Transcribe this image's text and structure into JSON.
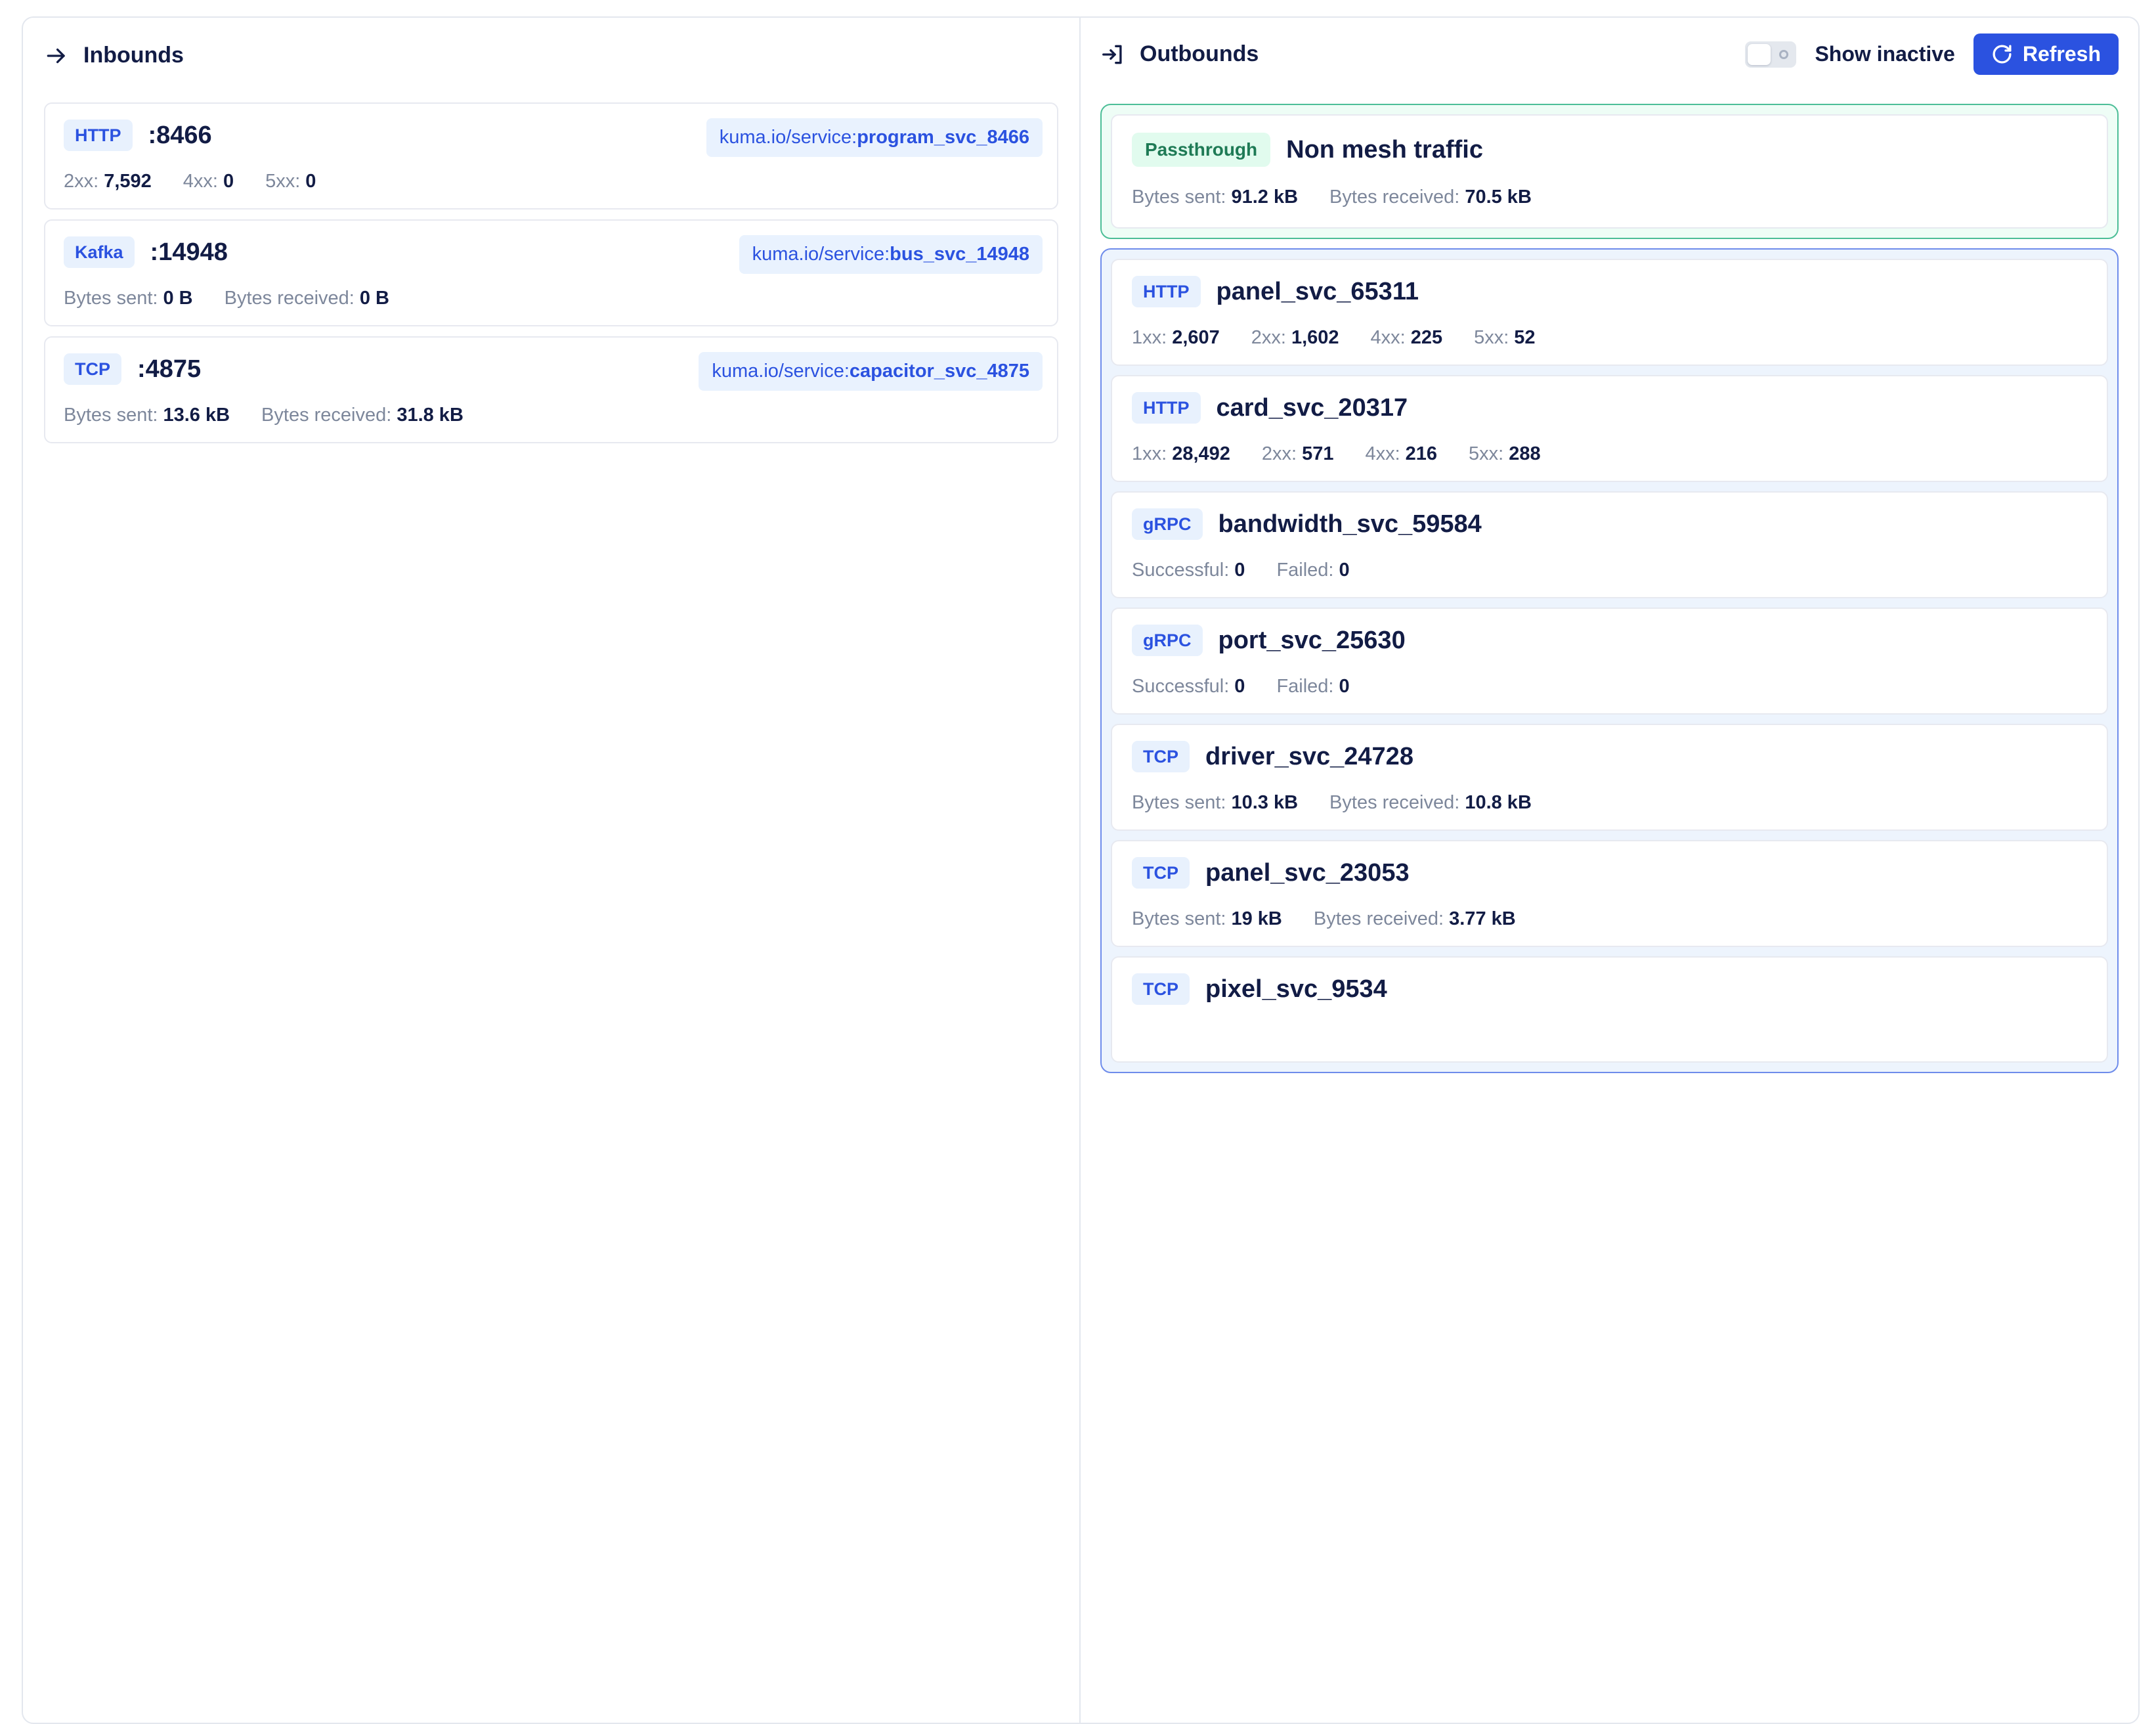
{
  "inbounds": {
    "title": "Inbounds",
    "items": [
      {
        "protocol": "HTTP",
        "port": ":8466",
        "tag_label": "kuma.io/service:",
        "tag_value": "program_svc_8466",
        "stats": [
          {
            "label": "2xx:",
            "value": "7,592"
          },
          {
            "label": "4xx:",
            "value": "0"
          },
          {
            "label": "5xx:",
            "value": "0"
          }
        ]
      },
      {
        "protocol": "Kafka",
        "port": ":14948",
        "tag_label": "kuma.io/service:",
        "tag_value": "bus_svc_14948",
        "stats": [
          {
            "label": "Bytes sent:",
            "value": "0 B"
          },
          {
            "label": "Bytes received:",
            "value": "0 B"
          }
        ]
      },
      {
        "protocol": "TCP",
        "port": ":4875",
        "tag_label": "kuma.io/service:",
        "tag_value": "capacitor_svc_4875",
        "stats": [
          {
            "label": "Bytes sent:",
            "value": "13.6 kB"
          },
          {
            "label": "Bytes received:",
            "value": "31.8 kB"
          }
        ]
      }
    ]
  },
  "outbounds": {
    "title": "Outbounds",
    "show_inactive_label": "Show inactive",
    "refresh_label": "Refresh",
    "passthrough": {
      "badge": "Passthrough",
      "title": "Non mesh traffic",
      "stats": [
        {
          "label": "Bytes sent:",
          "value": "91.2 kB"
        },
        {
          "label": "Bytes received:",
          "value": "70.5 kB"
        }
      ]
    },
    "items": [
      {
        "protocol": "HTTP",
        "name": "panel_svc_65311",
        "stats": [
          {
            "label": "1xx:",
            "value": "2,607"
          },
          {
            "label": "2xx:",
            "value": "1,602"
          },
          {
            "label": "4xx:",
            "value": "225"
          },
          {
            "label": "5xx:",
            "value": "52"
          }
        ]
      },
      {
        "protocol": "HTTP",
        "name": "card_svc_20317",
        "stats": [
          {
            "label": "1xx:",
            "value": "28,492"
          },
          {
            "label": "2xx:",
            "value": "571"
          },
          {
            "label": "4xx:",
            "value": "216"
          },
          {
            "label": "5xx:",
            "value": "288"
          }
        ]
      },
      {
        "protocol": "gRPC",
        "name": "bandwidth_svc_59584",
        "stats": [
          {
            "label": "Successful:",
            "value": "0"
          },
          {
            "label": "Failed:",
            "value": "0"
          }
        ]
      },
      {
        "protocol": "gRPC",
        "name": "port_svc_25630",
        "stats": [
          {
            "label": "Successful:",
            "value": "0"
          },
          {
            "label": "Failed:",
            "value": "0"
          }
        ]
      },
      {
        "protocol": "TCP",
        "name": "driver_svc_24728",
        "stats": [
          {
            "label": "Bytes sent:",
            "value": "10.3 kB"
          },
          {
            "label": "Bytes received:",
            "value": "10.8 kB"
          }
        ]
      },
      {
        "protocol": "TCP",
        "name": "panel_svc_23053",
        "stats": [
          {
            "label": "Bytes sent:",
            "value": "19 kB"
          },
          {
            "label": "Bytes received:",
            "value": "3.77 kB"
          }
        ]
      },
      {
        "protocol": "TCP",
        "name": "pixel_svc_9534",
        "stats": []
      }
    ]
  },
  "colors": {
    "accent_blue": "#2b52e0",
    "badge_bg": "#e8f1fd",
    "chip_bg": "#e9f2fe",
    "card_border": "#e7e9f0",
    "panel_border": "#e3e7ee",
    "text_dark": "#121c45",
    "text_muted": "#7d879b",
    "pass_border": "#4cbe97",
    "pass_bg": "#eefdf6",
    "pass_badge_bg": "#e1fbee",
    "pass_text": "#1e7a55",
    "out_border": "#6e8ceb",
    "out_bg": "#edf4fd",
    "toggle_track": "#e4e8ee",
    "toggle_dot": "#a9b2c2"
  },
  "icons": {
    "inbound": "arrow-right-icon",
    "outbound": "arrow-into-bracket-icon",
    "refresh": "refresh-icon"
  }
}
